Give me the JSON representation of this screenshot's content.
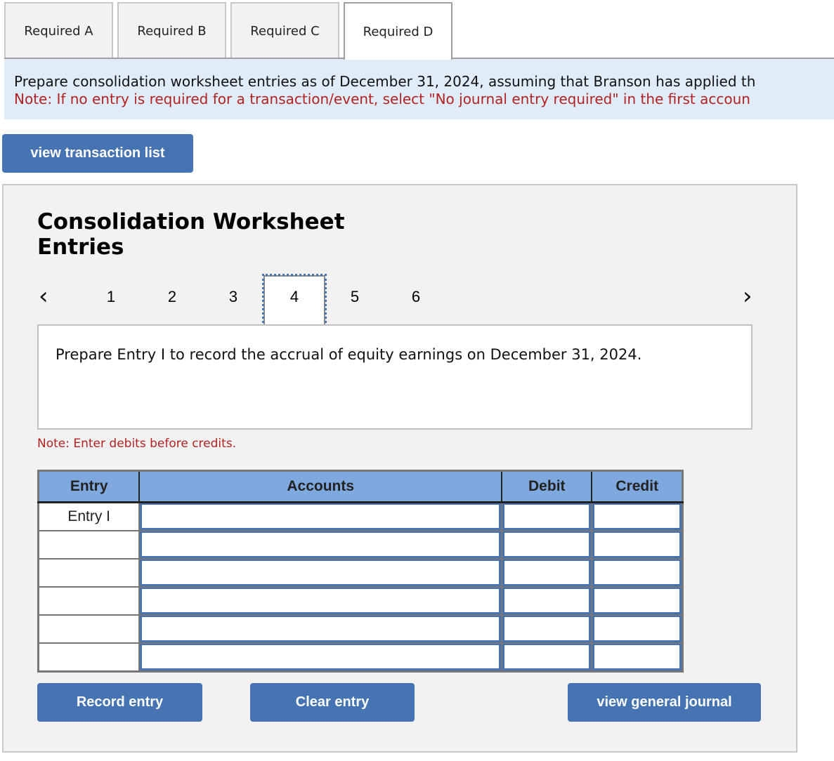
{
  "tabs": [
    {
      "label": "Required A",
      "active": false
    },
    {
      "label": "Required B",
      "active": false
    },
    {
      "label": "Required C",
      "active": false
    },
    {
      "label": "Required D",
      "active": true
    }
  ],
  "instructions": {
    "line1": "Prepare consolidation worksheet entries as of December 31, 2024, assuming that Branson has applied th",
    "line2": "Note: If no entry is required for a transaction/event, select \"No journal entry required\" in the first accoun"
  },
  "view_transaction_list_label": "view transaction list",
  "panel": {
    "title": "Consolidation Worksheet Entries",
    "pager": {
      "prev_icon": "chevron-left-icon",
      "next_icon": "chevron-right-icon",
      "pages": [
        "1",
        "2",
        "3",
        "4",
        "5",
        "6"
      ],
      "current": "4"
    },
    "question": "Prepare Entry I to record the accrual of equity earnings on December 31, 2024.",
    "note": "Note: Enter debits before credits.",
    "table": {
      "headers": [
        "Entry",
        "Accounts",
        "Debit",
        "Credit"
      ],
      "rows": [
        {
          "entry": "Entry I",
          "account": "",
          "debit": "",
          "credit": ""
        },
        {
          "entry": "",
          "account": "",
          "debit": "",
          "credit": ""
        },
        {
          "entry": "",
          "account": "",
          "debit": "",
          "credit": ""
        },
        {
          "entry": "",
          "account": "",
          "debit": "",
          "credit": ""
        },
        {
          "entry": "",
          "account": "",
          "debit": "",
          "credit": ""
        },
        {
          "entry": "",
          "account": "",
          "debit": "",
          "credit": ""
        }
      ]
    },
    "buttons": {
      "record": "Record entry",
      "clear": "Clear entry",
      "general_journal": "view general journal"
    }
  },
  "colors": {
    "accent": "#4674b2",
    "header_blue": "#7fa9de",
    "banner_bg": "#e0edf9",
    "note_red": "#b22222",
    "panel_bg": "#f2f2f2"
  }
}
